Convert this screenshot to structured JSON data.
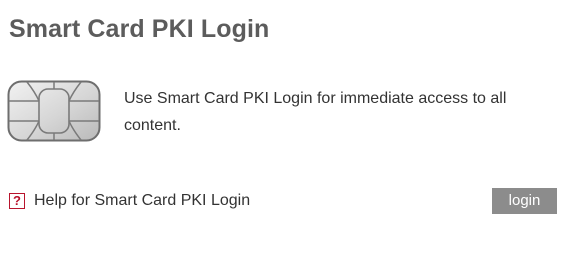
{
  "panel": {
    "title": "Smart Card PKI Login",
    "description": "Use Smart Card PKI Login for immediate access to all content.",
    "help_icon_glyph": "?",
    "help_link_text": "Help for Smart Card PKI Login",
    "login_button_label": "login"
  },
  "icons": {
    "chip": "smart-card-chip-icon",
    "help": "help-icon"
  },
  "colors": {
    "title": "#5c5c5c",
    "body_text": "#333333",
    "help_icon": "#b8142d",
    "button_bg": "#8c8c8c",
    "button_text": "#ffffff"
  }
}
